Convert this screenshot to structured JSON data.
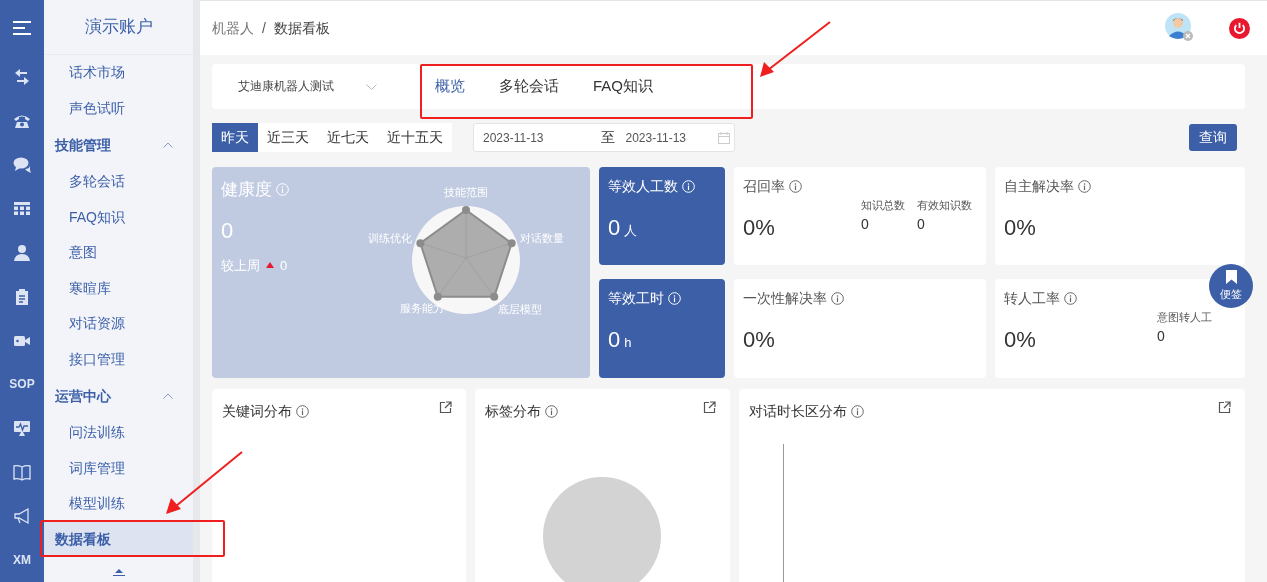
{
  "rail": {
    "items": [
      {
        "kind": "icon"
      },
      {
        "kind": "icon"
      },
      {
        "kind": "icon"
      },
      {
        "kind": "icon"
      },
      {
        "kind": "icon"
      },
      {
        "kind": "icon"
      },
      {
        "kind": "icon"
      },
      {
        "kind": "text",
        "text": "SOP"
      },
      {
        "kind": "icon"
      },
      {
        "kind": "icon"
      },
      {
        "kind": "icon"
      },
      {
        "kind": "text",
        "text": "XM"
      }
    ]
  },
  "sidebar": {
    "title": "演示账户",
    "items": [
      {
        "kind": "item",
        "label": "话术市场",
        "selected": false
      },
      {
        "kind": "item",
        "label": "声色试听",
        "selected": false
      },
      {
        "kind": "group",
        "label": "技能管理",
        "expanded": true,
        "children": [
          {
            "label": "多轮会话",
            "selected": false
          },
          {
            "label": "FAQ知识",
            "selected": false
          },
          {
            "label": "意图",
            "selected": false
          },
          {
            "label": "寒暄库",
            "selected": false
          },
          {
            "label": "对话资源",
            "selected": false
          },
          {
            "label": "接口管理",
            "selected": false
          }
        ]
      },
      {
        "kind": "group",
        "label": "运营中心",
        "expanded": true,
        "children": [
          {
            "label": "问法训练",
            "selected": false
          },
          {
            "label": "词库管理",
            "selected": false
          },
          {
            "label": "模型训练",
            "selected": false
          }
        ]
      },
      {
        "kind": "item",
        "label": "数据看板",
        "selected": true
      }
    ]
  },
  "breadcrumb": {
    "items": [
      "机器人",
      "数据看板"
    ],
    "separator": "/"
  },
  "robot_select": {
    "value": "艾迪康机器人测试"
  },
  "tabs": [
    {
      "label": "概览",
      "selected": true
    },
    {
      "label": "多轮会话",
      "selected": false
    },
    {
      "label": "FAQ知识",
      "selected": false
    }
  ],
  "ranges": [
    {
      "label": "昨天",
      "selected": true
    },
    {
      "label": "近三天",
      "selected": false
    },
    {
      "label": "近七天",
      "selected": false
    },
    {
      "label": "近十五天",
      "selected": false
    }
  ],
  "date_range": {
    "start": "2023-11-13",
    "separator": "至",
    "end": "2023-11-13"
  },
  "query_button": "查询",
  "health": {
    "title": "健康度",
    "value": "0",
    "compare_label": "较上周",
    "rising": true,
    "compare_value": "0",
    "radar_labels": [
      "技能范围",
      "对话数量",
      "底层模型",
      "服务能力",
      "训练优化"
    ]
  },
  "metrics": [
    {
      "kind": "solid",
      "title": "等效人工数",
      "value": "0",
      "unit": "人"
    },
    {
      "kind": "plain",
      "title": "召回率",
      "value": "0%",
      "stats": [
        {
          "label": "知识总数",
          "value": "0"
        },
        {
          "label": "有效知识数",
          "value": "0"
        }
      ]
    },
    {
      "kind": "plain",
      "title": "自主解决率",
      "value": "0%"
    },
    {
      "kind": "solid",
      "title": "等效工时",
      "value": "0",
      "unit": "h"
    },
    {
      "kind": "plain",
      "title": "一次性解决率",
      "value": "0%"
    },
    {
      "kind": "plain",
      "title": "转人工率",
      "value": "0%",
      "stats": [
        {
          "label": "意图转人工",
          "value": "0"
        }
      ]
    }
  ],
  "note_button": "便签",
  "panels": [
    {
      "title": "关键词分布",
      "kind": "empty"
    },
    {
      "title": "标签分布",
      "kind": "pie"
    },
    {
      "title": "对话时长区分布",
      "kind": "axis"
    }
  ]
}
